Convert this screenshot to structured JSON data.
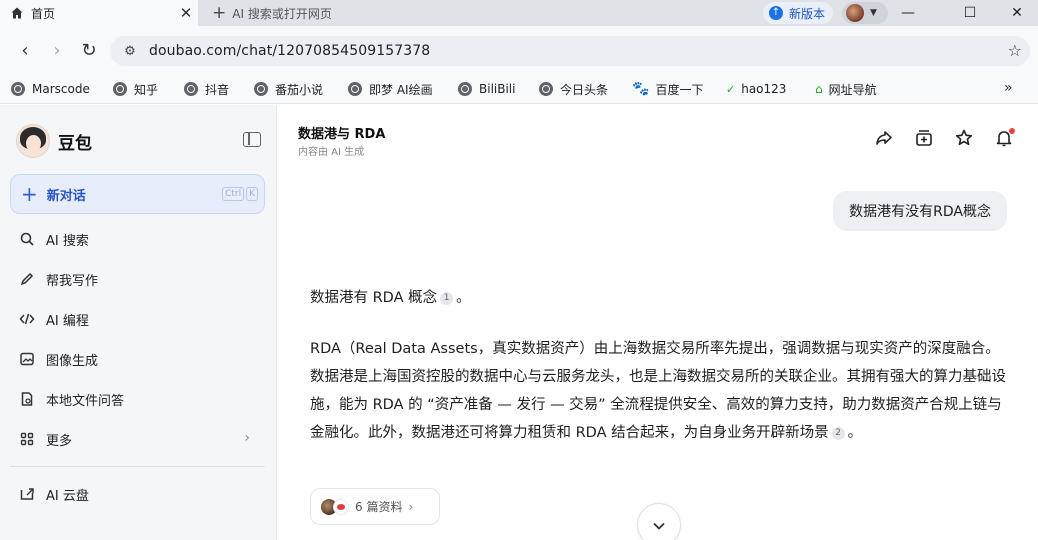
{
  "browser": {
    "tab": {
      "label": "首页",
      "close": "✕"
    },
    "new_tab": {
      "plus": "+",
      "label": "AI 搜索或打开网页"
    },
    "new_version": {
      "label": "新版本"
    },
    "window_controls": {
      "minimize": "—",
      "maximize": "☐",
      "close": "✕"
    },
    "nav": {
      "back": "‹",
      "forward": "›",
      "reload": "↻"
    },
    "address": {
      "url": "doubao.com/chat/12070854509157378"
    },
    "bookmarks": [
      {
        "label": "Marscode",
        "icon": "globe-icon"
      },
      {
        "label": "知乎",
        "icon": "globe-icon"
      },
      {
        "label": "抖音",
        "icon": "globe-icon"
      },
      {
        "label": "番茄小说",
        "icon": "globe-icon"
      },
      {
        "label": "即梦 AI绘画",
        "icon": "globe-icon"
      },
      {
        "label": "BiliBili",
        "icon": "globe-icon"
      },
      {
        "label": "今日头条",
        "icon": "globe-icon"
      },
      {
        "label": "百度一下",
        "icon": "baidu-paw-icon"
      },
      {
        "label": "hao123",
        "icon": "hao123-icon"
      },
      {
        "label": "网址导航",
        "icon": "nav-site-icon"
      }
    ],
    "bookmarks_more": "»"
  },
  "sidebar": {
    "brand": "豆包",
    "new_chat": {
      "label": "新对话",
      "shortcut": [
        "Ctrl",
        "K"
      ]
    },
    "items": [
      {
        "label": "AI 搜索",
        "icon": "search-icon"
      },
      {
        "label": "帮我写作",
        "icon": "pen-icon"
      },
      {
        "label": "AI 编程",
        "icon": "code-icon"
      },
      {
        "label": "图像生成",
        "icon": "image-icon"
      },
      {
        "label": "本地文件问答",
        "icon": "file-icon"
      },
      {
        "label": "更多",
        "icon": "grid-icon"
      },
      {
        "label": "AI 云盘",
        "icon": "cloud-drive-icon"
      }
    ]
  },
  "main": {
    "title": "数据港与 RDA",
    "subtitle": "内容由 AI 生成",
    "user_message": "数据港有没有RDA概念",
    "answer": {
      "line1": "数据港有 RDA 概念",
      "ref1": "1",
      "line1_end": "。",
      "para": "RDA（Real Data Assets，真实数据资产）由上海数据交易所率先提出，强调数据与现实资产的深度融合。数据港是上海国资控股的数据中心与云服务龙头，也是上海数据交易所的关联企业。其拥有强大的算力基础设施，能为 RDA 的 “资产准备 — 发行 — 交易” 全流程提供安全、高效的算力支持，助力数据资产合规上链与金融化。此外，数据港还可将算力租赁和 RDA 结合起来，为自身业务开辟新场景",
      "ref2": "2",
      "para_end": "。"
    },
    "sources": {
      "label": "6 篇资料",
      "chev": "›"
    },
    "scroll_down": "⌄"
  },
  "colors": {
    "accent": "#2b54c9",
    "new_chat_bg": "#e7edfb",
    "notification_dot": "#f04141"
  }
}
